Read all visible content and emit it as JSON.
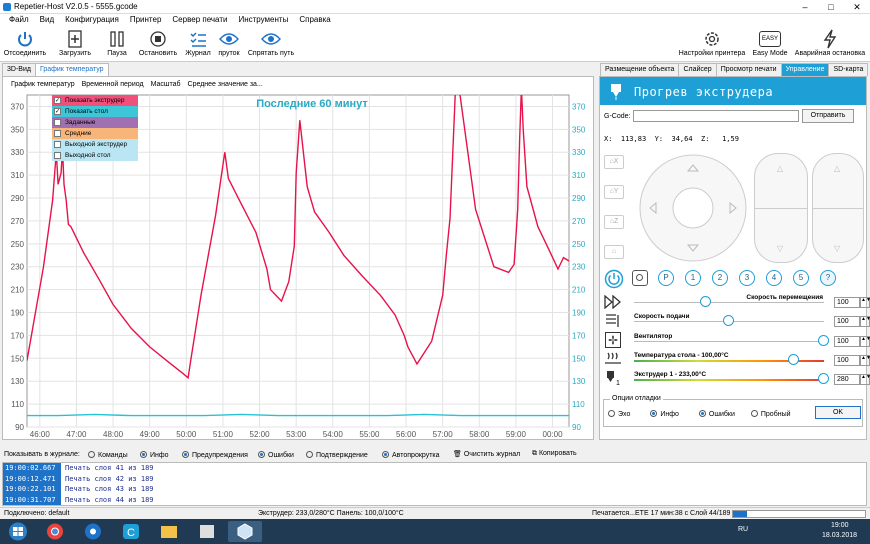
{
  "window": {
    "title": "Repetier-Host V2.0.5 - 5555.gcode"
  },
  "menu": [
    "Файл",
    "Вид",
    "Конфигурация",
    "Принтер",
    "Сервер печати",
    "Инструменты",
    "Справка"
  ],
  "toolbar": {
    "disconnect": "Отсоединить",
    "load": "Загрузить",
    "pause": "Пауза",
    "stop": "Остановить",
    "journal": "Журнал",
    "filament": "пруток",
    "hide_path": "Спрятать путь",
    "printer_settings": "Настройки принтера",
    "easy_mode": "Easy Mode",
    "easy_badge": "EASY",
    "emergency": "Аварийная остановка"
  },
  "left_tabs": [
    "3D-Вид",
    "График температур"
  ],
  "right_tabs": [
    "Размещение объекта",
    "Слайсер",
    "Просмотр печати",
    "Управление",
    "SD-карта"
  ],
  "chart_subbar": [
    "График температур",
    "Временной период",
    "Масштаб",
    "Среднее значение за..."
  ],
  "legend": [
    {
      "label": "Показать экструдер",
      "checked": true,
      "color": "#f0507a"
    },
    {
      "label": "Показать стол",
      "checked": true,
      "color": "#3cc6d8"
    },
    {
      "label": "Заданные",
      "checked": false,
      "color": "#a070b0"
    },
    {
      "label": "Средние",
      "checked": false,
      "color": "#f7b57a"
    },
    {
      "label": "Выходной экструдер",
      "checked": false,
      "color": "#b9e6f2"
    },
    {
      "label": "Выходной стол",
      "checked": false,
      "color": "#b9e6f2"
    }
  ],
  "chart_data": {
    "type": "line",
    "title": "Последние 60 минут",
    "x_ticks": [
      "46:00",
      "47:00",
      "48:00",
      "49:00",
      "50:00",
      "51:00",
      "52:00",
      "53:00",
      "54:00",
      "55:00",
      "56:00",
      "57:00",
      "58:00",
      "59:00",
      "00:00"
    ],
    "xlim": [
      45.65,
      60.45
    ],
    "ylim": [
      90,
      380
    ],
    "y_ticks": [
      90,
      110,
      130,
      150,
      170,
      190,
      210,
      230,
      250,
      270,
      290,
      310,
      330,
      350,
      370
    ],
    "grid": true,
    "series": [
      {
        "color": "#e8124a",
        "x": [
          45.65,
          46.1,
          46.35,
          46.45,
          46.5,
          46.58,
          46.62,
          46.66,
          46.72,
          46.78,
          46.85,
          47.2,
          47.6,
          48.0,
          48.5,
          49.0,
          49.5,
          49.9,
          50.05,
          50.12,
          50.4,
          50.8,
          51.05,
          51.15,
          51.5,
          51.9,
          52.2,
          52.3,
          52.6,
          52.8,
          52.95,
          53.0,
          53.1,
          53.3,
          53.5,
          53.9,
          54.3,
          54.8,
          55.3,
          55.7,
          55.95,
          56.05,
          56.3,
          56.7,
          57.0,
          57.1,
          57.2,
          57.35,
          57.45,
          57.9,
          58.4,
          58.8,
          58.95,
          59.05,
          59.1,
          59.15,
          59.2,
          59.3,
          59.6,
          59.9,
          60.15,
          60.3,
          60.45
        ],
        "y": [
          148,
          230,
          288,
          330,
          302,
          312,
          333,
          302,
          288,
          267,
          265,
          242,
          220,
          197,
          176,
          160,
          147,
          137,
          133,
          148,
          205,
          275,
          330,
          307,
          285,
          260,
          228,
          210,
          200,
          217,
          248,
          312,
          358,
          300,
          278,
          260,
          240,
          222,
          205,
          188,
          170,
          160,
          145,
          165,
          205,
          240,
          272,
          386,
          386,
          280,
          230,
          225,
          232,
          280,
          340,
          386,
          350,
          300,
          265,
          245,
          228,
          238,
          235
        ]
      },
      {
        "color": "#28c2d4",
        "x": [
          45.65,
          46.5,
          47.5,
          48.5,
          49.5,
          50.5,
          51.5,
          52.5,
          53.5,
          54.5,
          55.5,
          56.5,
          57.5,
          58.5,
          59.5,
          60.45
        ],
        "y": [
          100,
          100,
          101,
          100,
          100,
          100,
          101,
          100,
          100,
          100,
          100,
          101,
          100,
          100,
          100,
          100
        ]
      }
    ]
  },
  "control": {
    "header": "Прогрев экструдера",
    "gcode_label": "G-Code:",
    "send": "Отправить",
    "coords": {
      "x_label": "X:",
      "x": "113,83",
      "y_label": "Y:",
      "y": "34,64",
      "z_label": "Z:",
      "z": "1,59"
    },
    "home": [
      "X",
      "Y",
      "Z"
    ],
    "circle_buttons": [
      "P",
      "1",
      "2",
      "3",
      "4",
      "5",
      "?"
    ],
    "sliders": [
      {
        "label": "Скорость перемещения",
        "value": "100",
        "pos": 0.38
      },
      {
        "label": "Скорость подачи",
        "value": "100",
        "pos": 0.5
      },
      {
        "label": "Вентилятор",
        "value": "100",
        "pos": 1.0
      },
      {
        "label": "Температура стола - 100,00°C",
        "value": "100",
        "pos": 0.84
      },
      {
        "label": "Экструдер 1 - 233,00°C",
        "value": "280",
        "pos": 1.0
      }
    ],
    "options_title": "Опции отладки",
    "options": [
      {
        "label": "Эхо",
        "on": false
      },
      {
        "label": "Инфо",
        "on": true
      },
      {
        "label": "Ошибки",
        "on": true
      },
      {
        "label": "Пробный",
        "on": false
      }
    ],
    "ok": "OK"
  },
  "logbar": {
    "show": "Показывать в журнале:",
    "items": [
      {
        "label": "Команды",
        "on": false
      },
      {
        "label": "Инфо",
        "on": true
      },
      {
        "label": "Предупреждения",
        "on": true
      },
      {
        "label": "Ошибки",
        "on": true
      },
      {
        "label": "Подтверждение",
        "on": false
      },
      {
        "label": "Автопрокрутка",
        "on": true
      }
    ],
    "clear": "Очистить журнал",
    "copy": "Копировать"
  },
  "log": [
    {
      "t": "19:00:02.667",
      "m": "Печать слоя 41 из 189"
    },
    {
      "t": "19:00:12.471",
      "m": "Печать слоя 42 из 189"
    },
    {
      "t": "19:00:22.101",
      "m": "Печать слоя 43 из 189"
    },
    {
      "t": "19:00:31.707",
      "m": "Печать слоя 44 из 189"
    }
  ],
  "status": {
    "conn": "Подключено: default",
    "temps": "Экструдер: 233,0/280°C Панель: 100,0/100°C",
    "print": "Печатается...ETE 17 мин:38 с Слой 44/189"
  },
  "taskbar": {
    "lang": "RU",
    "time": "19:00",
    "date": "18.03.2018"
  }
}
